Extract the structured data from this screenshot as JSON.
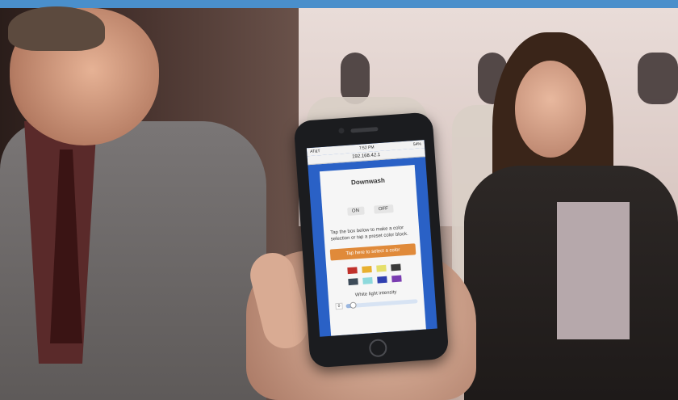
{
  "phone_screen": {
    "status": {
      "carrier": "AT&T",
      "time": "7:52 PM",
      "battery": "54%"
    },
    "url": "192.168.42.1",
    "title": "Downwash",
    "on_label": "ON",
    "off_label": "OFF",
    "instructions": "Tap the box below to make a color selection or tap a preset color block.",
    "select_color_label": "Tap here to select a color",
    "swatches": [
      "#c0312b",
      "#e8b02f",
      "#e5df6b",
      "#3a3a3a",
      "#3d4b59",
      "#8dd9dc",
      "#2f3fb0",
      "#7a3db1"
    ],
    "white_light_label": "White light intensity",
    "slider_value": "0",
    "slider_level": 0.1
  },
  "colors": {
    "top_bar": "#4a8fcb",
    "phone_screen_bg": "#2a61c6",
    "orange_button": "#e08a3a"
  }
}
